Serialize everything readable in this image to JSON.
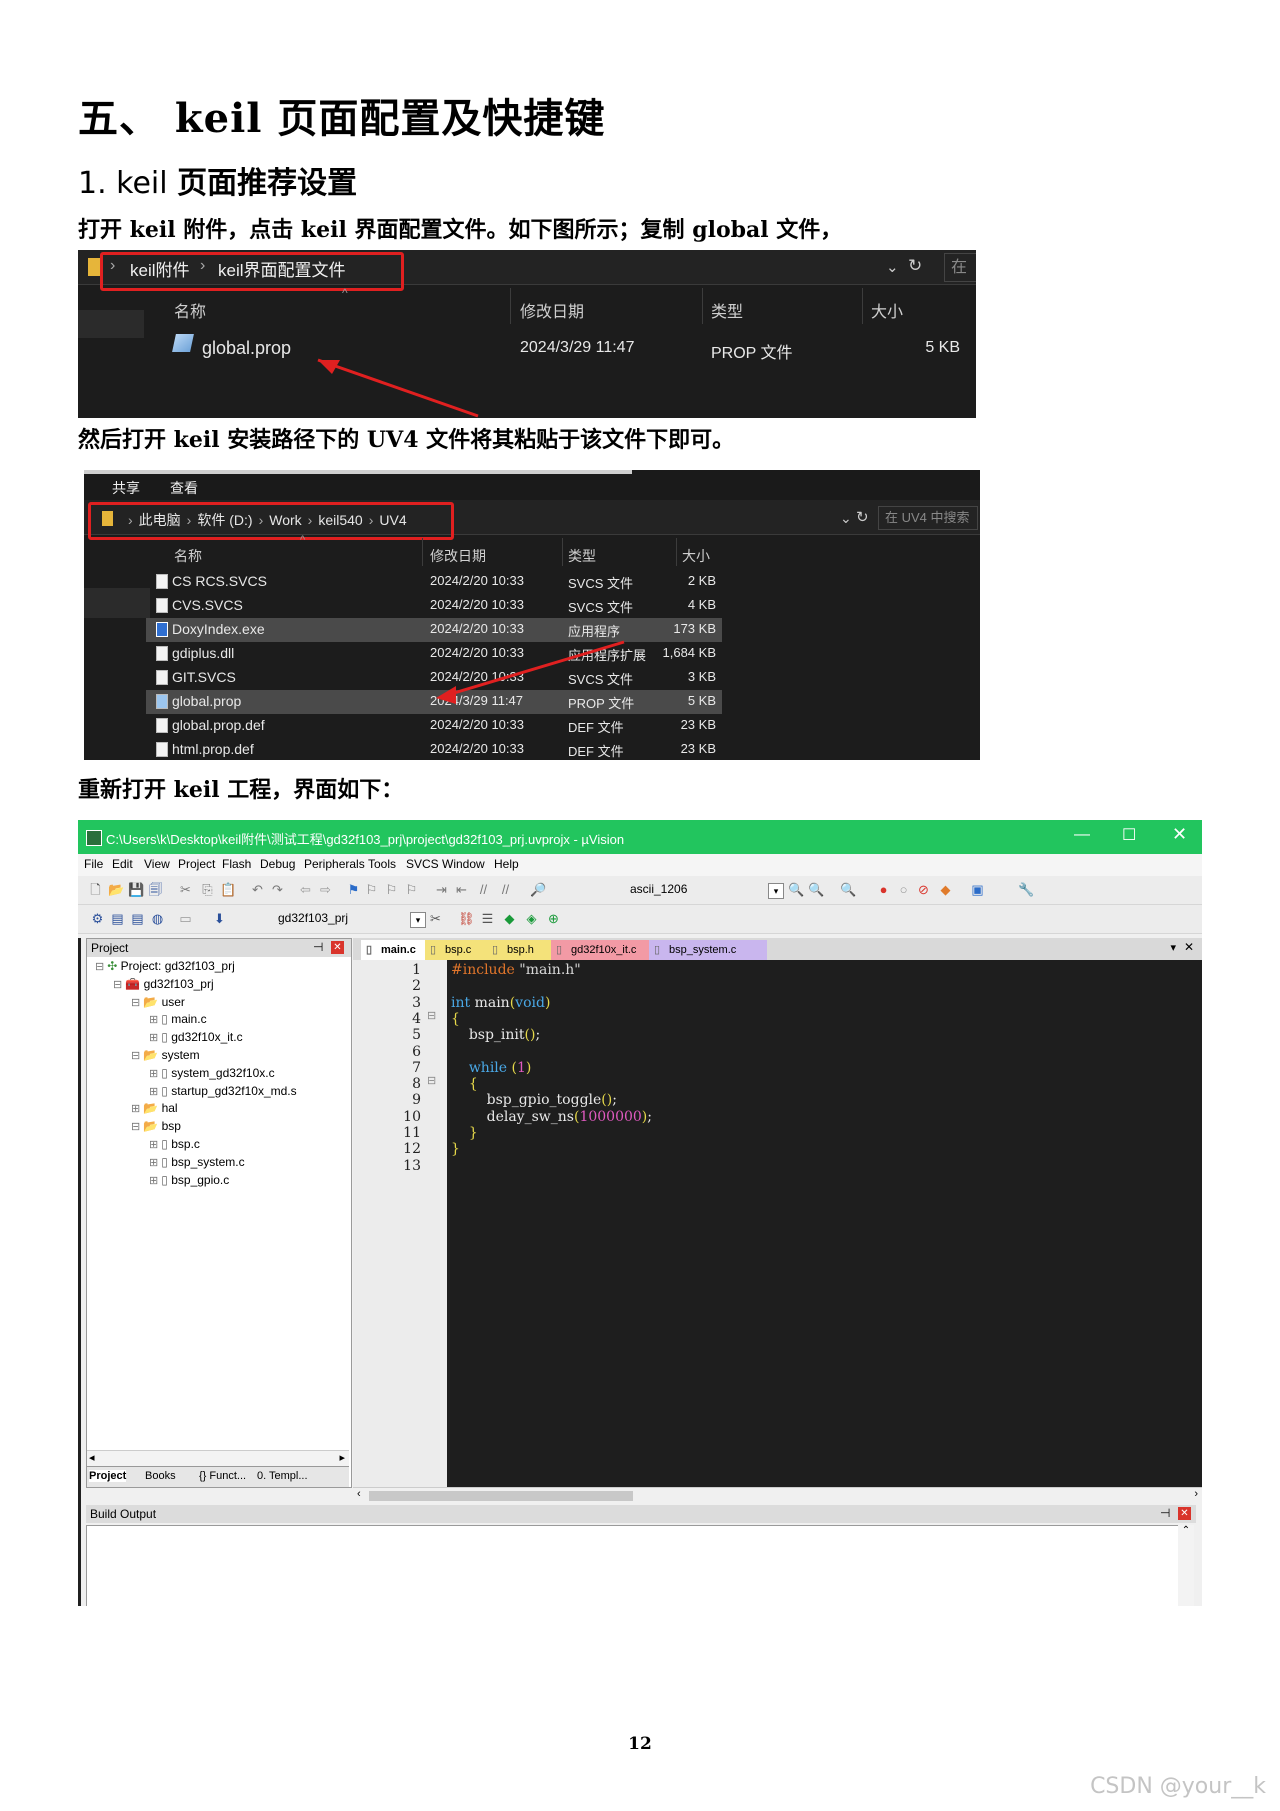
{
  "heading1": "五、 keil 页面配置及快捷键",
  "heading2": {
    "num": "1. keil",
    "text": "页面推荐设置"
  },
  "para1": "打开 keil 附件，点击 keil 界面配置文件。如下图所示；复制 global 文件，",
  "shot1": {
    "crumbs": [
      "keil附件",
      "keil界面配置文件"
    ],
    "search_placeholder": "在",
    "columns": [
      "名称",
      "修改日期",
      "类型",
      "大小"
    ],
    "file": {
      "name": "global.prop",
      "date": "2024/3/29 11:47",
      "type": "PROP 文件",
      "size": "5 KB"
    }
  },
  "para2": "然后打开 keil 安装路径下的 UV4 文件将其粘贴于该文件下即可。",
  "shot2": {
    "ribbon": [
      "共享",
      "查看"
    ],
    "crumbs": [
      "此电脑",
      "软件 (D:)",
      "Work",
      "keil540",
      "UV4"
    ],
    "search_placeholder": "在 UV4 中搜索",
    "columns": [
      "名称",
      "修改日期",
      "类型",
      "大小"
    ],
    "files": [
      {
        "name": "CS RCS.SVCS",
        "date": "2024/2/20 10:33",
        "type": "SVCS 文件",
        "size": "2 KB",
        "icon": "file"
      },
      {
        "name": "CVS.SVCS",
        "date": "2024/2/20 10:33",
        "type": "SVCS 文件",
        "size": "4 KB",
        "icon": "file"
      },
      {
        "name": "DoxyIndex.exe",
        "date": "2024/2/20 10:33",
        "type": "应用程序",
        "size": "173 KB",
        "icon": "exe"
      },
      {
        "name": "gdiplus.dll",
        "date": "2024/2/20 10:33",
        "type": "应用程序扩展",
        "size": "1,684 KB",
        "icon": "dll"
      },
      {
        "name": "GIT.SVCS",
        "date": "2024/2/20 10:33",
        "type": "SVCS 文件",
        "size": "3 KB",
        "icon": "file"
      },
      {
        "name": "global.prop",
        "date": "2024/3/29 11:47",
        "type": "PROP 文件",
        "size": "5 KB",
        "icon": "prop"
      },
      {
        "name": "global.prop.def",
        "date": "2024/2/20 10:33",
        "type": "DEF 文件",
        "size": "23 KB",
        "icon": "file"
      },
      {
        "name": "html.prop.def",
        "date": "2024/2/20 10:33",
        "type": "DEF 文件",
        "size": "23 KB",
        "icon": "file"
      }
    ]
  },
  "para3": "重新打开 keil 工程，界面如下：",
  "uvision": {
    "title": "C:\\Users\\k\\Desktop\\keil附件\\测试工程\\gd32f103_prj\\project\\gd32f103_prj.uvprojx - µVision",
    "menu": [
      "File",
      "Edit",
      "View",
      "Project",
      "Flash",
      "Debug",
      "Peripherals",
      "Tools",
      "SVCS",
      "Window",
      "Help"
    ],
    "toolbar_combo": "ascii_1206",
    "target_combo": "gd32f103_prj",
    "project_pane_title": "Project",
    "tree": [
      {
        "label": "Project: gd32f103_prj",
        "indent": 0,
        "icon": "project"
      },
      {
        "label": "gd32f103_prj",
        "indent": 1,
        "icon": "target"
      },
      {
        "label": "user",
        "indent": 2,
        "icon": "folder"
      },
      {
        "label": "main.c",
        "indent": 3,
        "icon": "file"
      },
      {
        "label": "gd32f10x_it.c",
        "indent": 3,
        "icon": "file"
      },
      {
        "label": "system",
        "indent": 2,
        "icon": "folder"
      },
      {
        "label": "system_gd32f10x.c",
        "indent": 3,
        "icon": "file"
      },
      {
        "label": "startup_gd32f10x_md.s",
        "indent": 3,
        "icon": "file"
      },
      {
        "label": "hal",
        "indent": 2,
        "icon": "folder"
      },
      {
        "label": "bsp",
        "indent": 2,
        "icon": "folder"
      },
      {
        "label": "bsp.c",
        "indent": 3,
        "icon": "file"
      },
      {
        "label": "bsp_system.c",
        "indent": 3,
        "icon": "file"
      },
      {
        "label": "bsp_gpio.c",
        "indent": 3,
        "icon": "file"
      }
    ],
    "bottom_tabs": [
      "Project",
      "Books",
      "{} Funct...",
      "0. Templ..."
    ],
    "editor_tabs": [
      "main.c",
      "bsp.c",
      "bsp.h",
      "gd32f10x_it.c",
      "bsp_system.c"
    ],
    "code_lines": [
      "#include \"main.h\"",
      "",
      "int main(void)",
      "{",
      "    bsp_init();",
      "",
      "    while (1)",
      "    {",
      "        bsp_gpio_toggle();",
      "        delay_sw_ns(1000000);",
      "    }",
      "}",
      ""
    ],
    "build_output_title": "Build Output"
  },
  "page_number": "12",
  "watermark": "CSDN @your__k"
}
